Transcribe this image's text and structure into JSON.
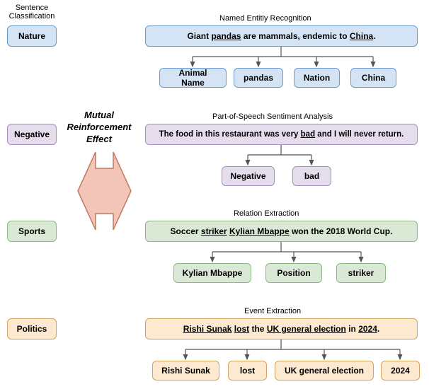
{
  "leftHeader": "Sentence\nClassification",
  "mre": "Mutual\nReinforcement\nEffect",
  "section1": {
    "classify": "Nature",
    "title": "Named Entitiy Recognition",
    "sentence_pre": "Giant ",
    "sentence_u1": "pandas",
    "sentence_mid": " are mammals, endemic to ",
    "sentence_u2": "China",
    "sentence_post": ".",
    "e1": "Animal Name",
    "e2": "pandas",
    "e3": "Nation",
    "e4": "China"
  },
  "section2": {
    "classify": "Negative",
    "title": "Part-of-Speech Sentiment Analysis",
    "sentence_pre": "The food in this restaurant was very ",
    "sentence_u1": "bad",
    "sentence_post": " and I will never return.",
    "e1": "Negative",
    "e2": "bad"
  },
  "section3": {
    "classify": "Sports",
    "title": "Relation Extraction",
    "sentence_pre": "Soccer ",
    "sentence_u1": "striker",
    "sentence_sp": " ",
    "sentence_u2": "Kylian Mbappe",
    "sentence_post": " won the 2018 World Cup.",
    "e1": "Kylian Mbappe",
    "e2": "Position",
    "e3": "striker"
  },
  "section4": {
    "classify": "Politics",
    "title": "Event Extraction",
    "sentence_u1": "Rishi Sunak",
    "sentence_sp1": " ",
    "sentence_u2": "lost",
    "sentence_sp2": " the ",
    "sentence_u3": "UK general election",
    "sentence_sp3": " in ",
    "sentence_u4": "2024",
    "sentence_post": ".",
    "e1": "Rishi Sunak",
    "e2": "lost",
    "e3": "UK general election",
    "e4": "2024"
  }
}
